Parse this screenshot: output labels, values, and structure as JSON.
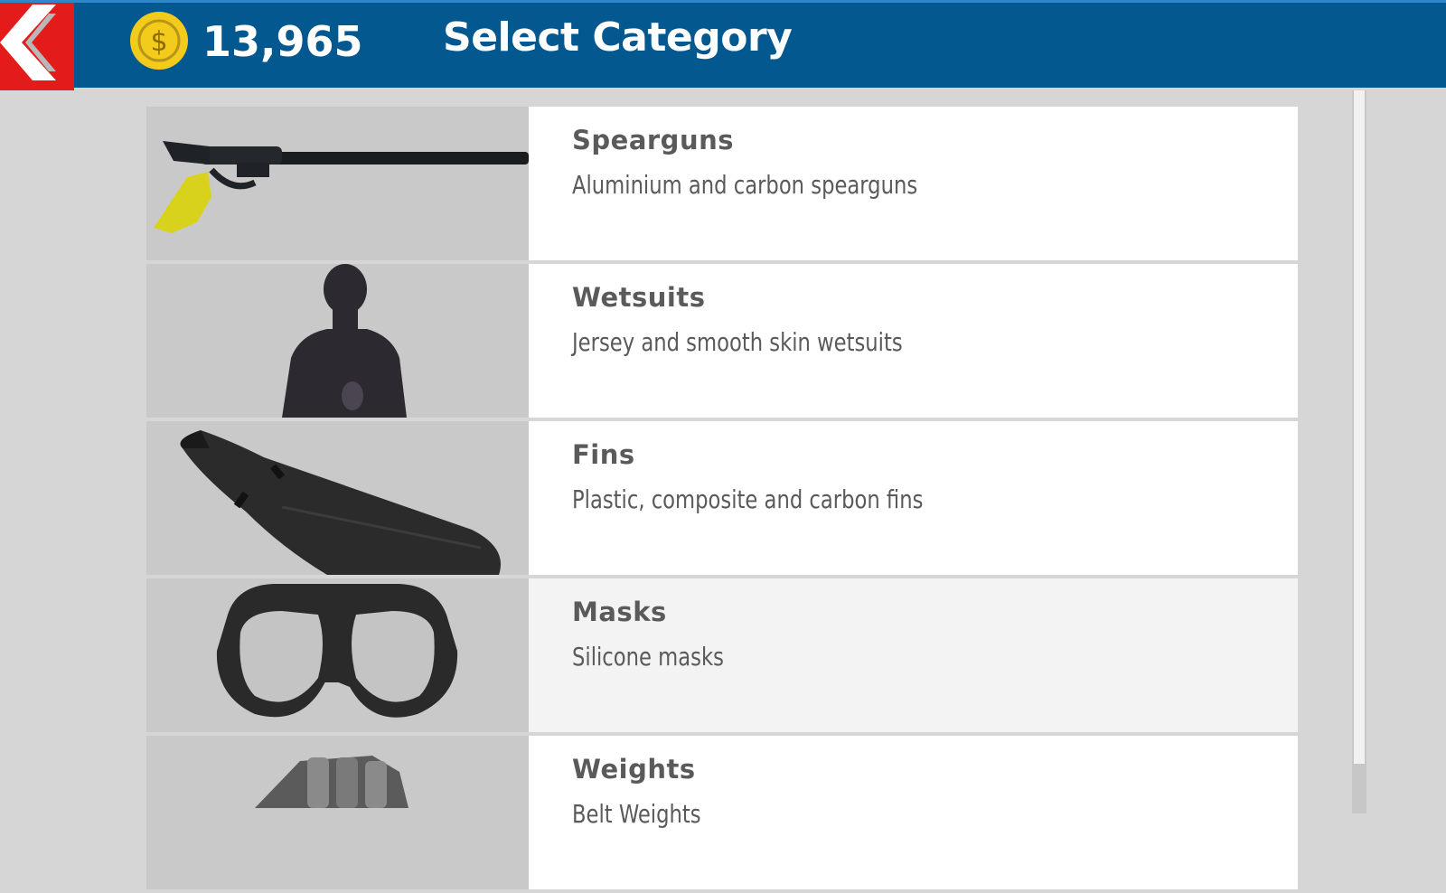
{
  "header": {
    "back_icon": "chevron-left-icon",
    "coin_icon": "coin-icon",
    "coin_symbol": "$",
    "balance": "13,965",
    "title": "Select Category"
  },
  "categories": [
    {
      "name": "Spearguns",
      "description": "Aluminium and carbon spearguns",
      "icon": "speargun-icon"
    },
    {
      "name": "Wetsuits",
      "description": "Jersey and smooth skin wetsuits",
      "icon": "wetsuit-icon"
    },
    {
      "name": "Fins",
      "description": "Plastic, composite and carbon fins",
      "icon": "fins-icon"
    },
    {
      "name": "Masks",
      "description": "Silicone masks",
      "icon": "mask-icon",
      "highlighted": true
    },
    {
      "name": "Weights",
      "description": "Belt Weights",
      "icon": "weights-icon"
    }
  ],
  "colors": {
    "header": "#03588f",
    "back_button": "#e41b1b",
    "coin": "#f3cc1b",
    "text": "#5a5a5a"
  }
}
